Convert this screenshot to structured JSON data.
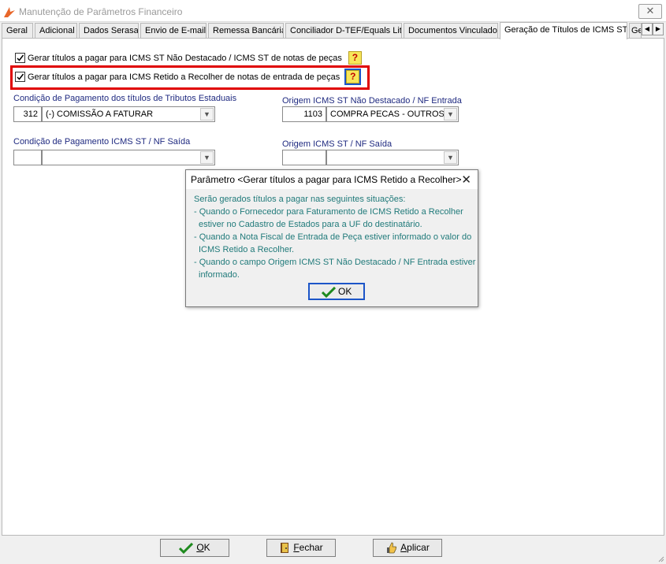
{
  "window": {
    "title": "Manutenção de Parâmetros Financeiro",
    "close_glyph": "✕"
  },
  "tabs": [
    {
      "label": "Geral"
    },
    {
      "label": "Adicional"
    },
    {
      "label": "Dados Serasa"
    },
    {
      "label": "Envio de E-mail"
    },
    {
      "label": "Remessa Bancária"
    },
    {
      "label": "Conciliador D-TEF/Equals Lite"
    },
    {
      "label": "Documentos Vinculados"
    },
    {
      "label": "Geração de Títulos de ICMS ST"
    },
    {
      "label": "Ge"
    }
  ],
  "active_tab": "Geração de Títulos de ICMS ST",
  "options": {
    "opt1_label": "Gerar títulos a pagar para ICMS ST Não Destacado / ICMS ST de notas de peças",
    "opt2_label": "Gerar títulos a pagar para ICMS Retido a Recolher de notas de entrada de peças",
    "opt1_checked": true,
    "opt2_checked": true,
    "help_glyph": "?"
  },
  "fields": {
    "cond_pag_estaduais": {
      "label": "Condição de Pagamento dos títulos de Tributos Estaduais",
      "code": "312",
      "value": "(-) COMISSÃO A FATURAR"
    },
    "origem_entrada": {
      "label": "Origem ICMS ST Não Destacado / NF Entrada",
      "code": "1103",
      "value": "COMPRA PECAS - OUTROS"
    },
    "cond_pag_saida": {
      "label": "Condição de Pagamento ICMS ST / NF Saída",
      "code": "",
      "value": ""
    },
    "origem_saida": {
      "label": "Origem ICMS ST / NF Saída",
      "code": "",
      "value": ""
    }
  },
  "dialog": {
    "title": "Parâmetro <Gerar títulos a pagar para ICMS Retido a Recolher>",
    "lines": [
      "Serão gerados títulos a pagar nas seguintes situações:",
      "- Quando o Fornecedor para Faturamento de ICMS Retido a Recolher",
      "  estiver no Cadastro de Estados para a UF do destinatário.",
      "- Quando a Nota Fiscal de Entrada de Peça estiver informado o valor do",
      "  ICMS Retido a Recolher.",
      "- Quando o campo Origem ICMS ST Não Destacado / NF Entrada estiver",
      "  informado."
    ],
    "ok_label": "OK",
    "text_color": "#207a7a"
  },
  "footer": {
    "ok_first": "O",
    "ok_rest": "K",
    "fechar_first": "F",
    "fechar_rest": "echar",
    "aplicar_first": "A",
    "aplicar_rest": "plicar"
  },
  "colors": {
    "highlight": "#e00000",
    "label_blue": "#1f2a80",
    "focus_blue": "#1c55c8"
  }
}
